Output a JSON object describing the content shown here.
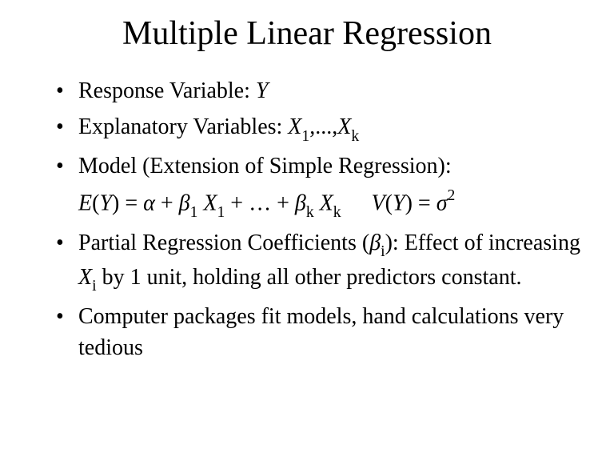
{
  "title": "Multiple Linear Regression",
  "bullets": {
    "b1_prefix": "Response Variable: ",
    "b1_var": "Y",
    "b2_prefix": "Explanatory Variables: ",
    "b2_var1": "X",
    "b2_sub1": "1",
    "b2_mid": ",...,",
    "b2_var2": "X",
    "b2_sub2": "k",
    "b3": "Model (Extension of Simple Regression):",
    "eq_E": "E",
    "eq_open": "(",
    "eq_Y": "Y",
    "eq_close_eq": ") = ",
    "eq_alpha": "α",
    "eq_plus1": " + ",
    "eq_beta1": "β",
    "eq_beta1_sub": "1",
    "eq_sp1": " ",
    "eq_X1": "X",
    "eq_X1_sub": "1",
    "eq_plus2": " + … + ",
    "eq_betak": "β",
    "eq_betak_sub": "k",
    "eq_sp2": " ",
    "eq_Xk": "X",
    "eq_Xk_sub": "k",
    "eq_V": "V",
    "eq_Vopen": "(",
    "eq_VY": "Y",
    "eq_Vclose": ") = ",
    "eq_sigma": "σ",
    "eq_sigma_sup": "2",
    "b4_p1": "Partial Regression Coefficients (",
    "b4_beta": "β",
    "b4_beta_sub": "i",
    "b4_p2": "): Effect of increasing ",
    "b4_X": "X",
    "b4_X_sub": "i",
    "b4_p3": " by 1 unit, holding all other predictors constant.",
    "b5": "Computer packages fit models, hand calculations very tedious"
  }
}
